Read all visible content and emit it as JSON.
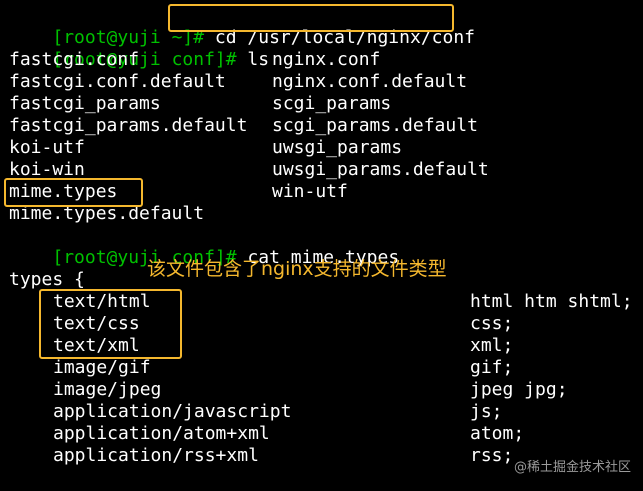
{
  "terminal": {
    "lines": [
      {
        "prompt": "[root@yuji ~]#",
        "cmd": " cd /usr/local/nginx/conf"
      },
      {
        "prompt": "[root@yuji conf]#",
        "cmd": " ls"
      },
      {
        "cmd": "cat mime.types"
      }
    ],
    "ls_left": [
      "fastcgi.conf",
      "fastcgi.conf.default",
      "fastcgi_params",
      "fastcgi_params.default",
      "koi-utf",
      "koi-win",
      "mime.types",
      "mime.types.default"
    ],
    "ls_right": [
      "nginx.conf",
      "nginx.conf.default",
      "scgi_params",
      "scgi_params.default",
      "uwsgi_params",
      "uwsgi_params.default",
      "win-utf"
    ],
    "prompt3": "[root@yuji conf]#",
    "types_open": "types {",
    "mime_rows": [
      {
        "type": "text/html",
        "ext": "html htm shtml;"
      },
      {
        "type": "text/css",
        "ext": "css;"
      },
      {
        "type": "text/xml",
        "ext": "xml;"
      },
      {
        "type": "image/gif",
        "ext": "gif;"
      },
      {
        "type": "image/jpeg",
        "ext": "jpeg jpg;"
      },
      {
        "type": "application/javascript",
        "ext": "js;"
      },
      {
        "type": "application/atom+xml",
        "ext": "atom;"
      },
      {
        "type": "application/rss+xml",
        "ext": "rss;"
      }
    ]
  },
  "annotation": "该文件包含了nginx支持的文件类型",
  "watermark": "@稀土掘金技术社区",
  "colors": {
    "background": "#000000",
    "prompt": "#00c000",
    "text": "#ffffff",
    "highlight": "#f5b82e"
  }
}
